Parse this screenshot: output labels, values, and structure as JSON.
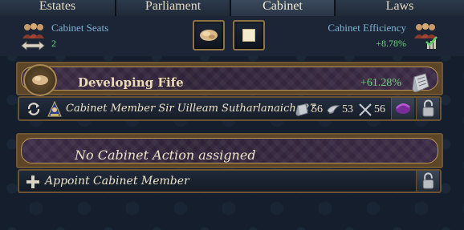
{
  "tabs": [
    {
      "label": "Estates"
    },
    {
      "label": "Parliament"
    },
    {
      "label": "Cabinet"
    },
    {
      "label": "Laws"
    }
  ],
  "stats": {
    "seats_label": "Cabinet Seats",
    "seats_value": "2",
    "efficiency_label": "Cabinet Efficiency",
    "efficiency_value": "+8.78%"
  },
  "agenda": {
    "title": "Developing Fife",
    "value": "+61.28%"
  },
  "member": {
    "name": "Cabinet Member Sir Uilleam Sutharlanaich, 27",
    "adm": "56",
    "dip": "53",
    "mil": "56"
  },
  "action": {
    "text": "No Cabinet Action assigned"
  },
  "appoint": {
    "text": "Appoint Cabinet Member"
  },
  "colors": {
    "positive": "#6fd37d",
    "label_blue": "#7fb5d6",
    "gold_border": "#8d7447",
    "banner_purple": "#2f2238"
  },
  "icons": [
    "people-icon",
    "arrows-icon",
    "traits-icon",
    "blank-square-icon",
    "efficiency-icon",
    "agenda-medal-icon",
    "scroll-icon",
    "cycle-icon",
    "portrait-icon",
    "adm-icon",
    "dip-icon",
    "mil-icon",
    "party-icon",
    "lock-icon",
    "plus-icon"
  ]
}
